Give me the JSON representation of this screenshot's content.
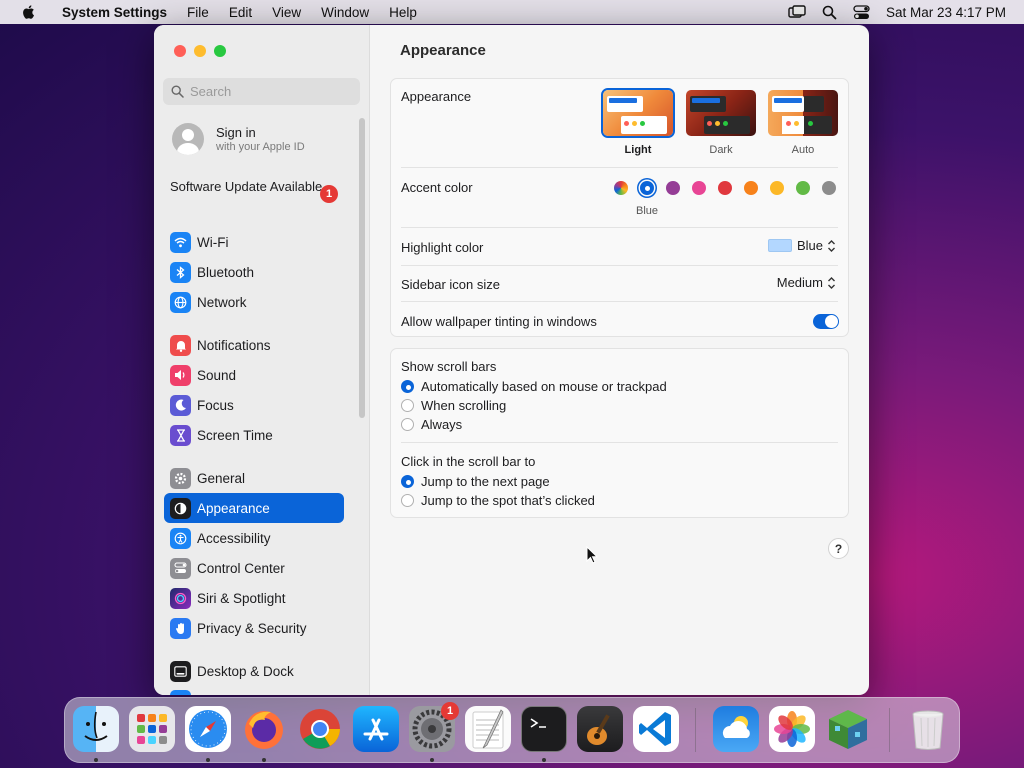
{
  "menubar": {
    "app_name": "System Settings",
    "items": [
      "File",
      "Edit",
      "View",
      "Window",
      "Help"
    ],
    "clock": "Sat Mar 23  4:17 PM"
  },
  "sidebar": {
    "search_placeholder": "Search",
    "signin_title": "Sign in",
    "signin_subtitle": "with your Apple ID",
    "update_label": "Software Update Available",
    "update_badge": "1",
    "items": [
      {
        "label": "Wi-Fi",
        "icon": "wifi-icon",
        "color": "#1a84f5"
      },
      {
        "label": "Bluetooth",
        "icon": "bluetooth-icon",
        "color": "#1a84f5"
      },
      {
        "label": "Network",
        "icon": "globe-icon",
        "color": "#1a84f5"
      },
      {
        "label": "Notifications",
        "icon": "bell-icon",
        "color": "#ef4c4c"
      },
      {
        "label": "Sound",
        "icon": "speaker-icon",
        "color": "#ef3f6a"
      },
      {
        "label": "Focus",
        "icon": "moon-icon",
        "color": "#5b5bd6"
      },
      {
        "label": "Screen Time",
        "icon": "hourglass-icon",
        "color": "#6a4dcf"
      },
      {
        "label": "General",
        "icon": "gear-icon",
        "color": "#8e8e93"
      },
      {
        "label": "Appearance",
        "icon": "appearance-icon",
        "color": "#1d1d1f"
      },
      {
        "label": "Accessibility",
        "icon": "accessibility-icon",
        "color": "#1a84f5"
      },
      {
        "label": "Control Center",
        "icon": "switches-icon",
        "color": "#8e8e93"
      },
      {
        "label": "Siri & Spotlight",
        "icon": "siri-icon",
        "color": "#7b3bd4"
      },
      {
        "label": "Privacy & Security",
        "icon": "hand-icon",
        "color": "#2a7af2"
      },
      {
        "label": "Desktop & Dock",
        "icon": "dock-icon",
        "color": "#1d1d1f"
      }
    ]
  },
  "content": {
    "title": "Appearance",
    "appearance": {
      "label": "Appearance",
      "options": [
        "Light",
        "Dark",
        "Auto"
      ],
      "selected": "Light"
    },
    "accent": {
      "label": "Accent color",
      "selected_name": "Blue",
      "colors": [
        "#0a64d8",
        "#953d96",
        "#e84595",
        "#e0383e",
        "#f7821b",
        "#fcb827",
        "#62ba46",
        "#8c8c8c"
      ]
    },
    "highlight": {
      "label": "Highlight color",
      "value": "Blue",
      "swatch": "#b3d7ff"
    },
    "sidebar_icon": {
      "label": "Sidebar icon size",
      "value": "Medium"
    },
    "wallpaper_tint": {
      "label": "Allow wallpaper tinting in windows",
      "enabled": true
    },
    "scrollbars": {
      "label": "Show scroll bars",
      "options": [
        "Automatically based on mouse or trackpad",
        "When scrolling",
        "Always"
      ],
      "selected_index": 0
    },
    "click_scroll": {
      "label": "Click in the scroll bar to",
      "options": [
        "Jump to the next page",
        "Jump to the spot that’s clicked"
      ],
      "selected_index": 0
    },
    "help": "?"
  },
  "dock": {
    "apps": [
      "Finder",
      "Launchpad",
      "Safari",
      "Firefox",
      "Chrome",
      "App Store",
      "System Settings",
      "TextEdit",
      "Terminal",
      "GarageBand",
      "VS Code",
      "Weather",
      "Photos",
      "Minecraft",
      "Trash"
    ],
    "settings_badge": "1"
  }
}
